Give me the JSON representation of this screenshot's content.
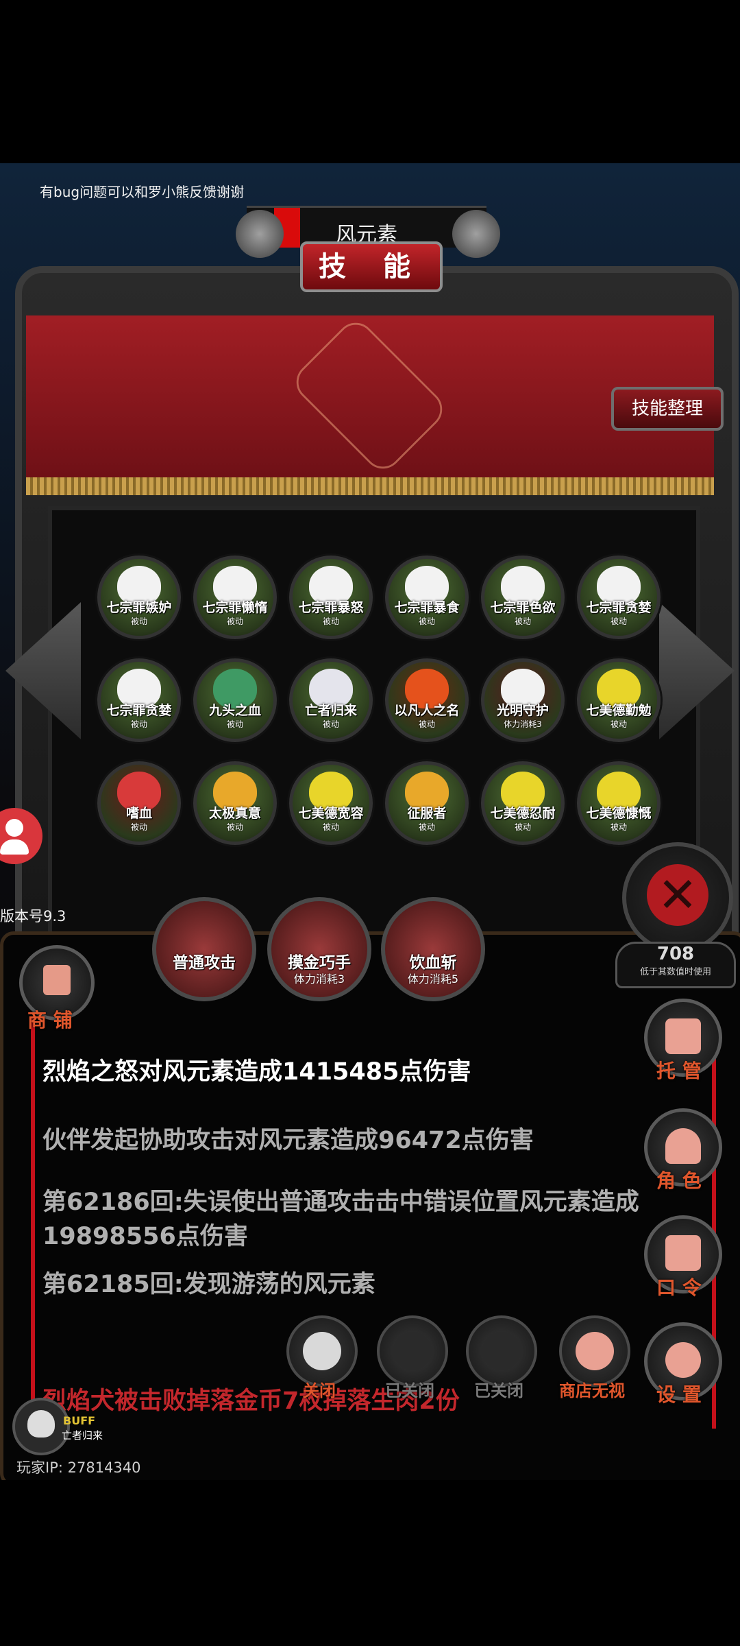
{
  "feedback_note": "有bug问题可以和罗小熊反馈谢谢",
  "target_name": "风元素",
  "panel_title": "技 能",
  "organize_button": "技能整理",
  "skills": [
    {
      "name": "七宗罪嫉妒",
      "sub": "被动",
      "glyph": "mask-icon",
      "bg": "#4f6e34",
      "glyph_color": "#f2f2f2"
    },
    {
      "name": "七宗罪懒惰",
      "sub": "被动",
      "glyph": "mask-icon",
      "bg": "#4f6e34",
      "glyph_color": "#f2f2f2"
    },
    {
      "name": "七宗罪暴怒",
      "sub": "被动",
      "glyph": "mask-icon",
      "bg": "#4f6e34",
      "glyph_color": "#f2f2f2"
    },
    {
      "name": "七宗罪暴食",
      "sub": "被动",
      "glyph": "mask-icon",
      "bg": "#4f6e34",
      "glyph_color": "#f2f2f2"
    },
    {
      "name": "七宗罪色欲",
      "sub": "被动",
      "glyph": "mask-icon",
      "bg": "#4f6e34",
      "glyph_color": "#f2f2f2"
    },
    {
      "name": "七宗罪贪婪",
      "sub": "被动",
      "glyph": "mask-icon",
      "bg": "#4f6e34",
      "glyph_color": "#f2f2f2"
    },
    {
      "name": "七宗罪贪婪",
      "sub": "被动",
      "glyph": "mask-icon",
      "bg": "#4f6e34",
      "glyph_color": "#f2f2f2"
    },
    {
      "name": "九头之血",
      "sub": "被动",
      "glyph": "hydra-icon",
      "bg": "#4f6e34",
      "glyph_color": "#3f9a64"
    },
    {
      "name": "亡者归来",
      "sub": "被动",
      "glyph": "skull-icon",
      "bg": "#4f6e34",
      "glyph_color": "#e4e4ec"
    },
    {
      "name": "以凡人之名",
      "sub": "被动",
      "glyph": "figure-icon",
      "bg": "#6a2a10",
      "glyph_color": "#e5521c"
    },
    {
      "name": "光明守护",
      "sub": "体力消耗3",
      "glyph": "hand-icon",
      "bg": "#5a1a1e",
      "glyph_color": "#f2f2f2"
    },
    {
      "name": "七美德勤勉",
      "sub": "被动",
      "glyph": "tear-icon",
      "bg": "#4f6e34",
      "glyph_color": "#e8d52a"
    },
    {
      "name": "嗜血",
      "sub": "被动",
      "glyph": "fangs-icon",
      "bg": "#6a1a1a",
      "glyph_color": "#d83a3a"
    },
    {
      "name": "太极真意",
      "sub": "被动",
      "glyph": "cloud-icon",
      "bg": "#4f6e34",
      "glyph_color": "#e8a82a"
    },
    {
      "name": "七美德宽容",
      "sub": "被动",
      "glyph": "ribbon-icon",
      "bg": "#4f6e34",
      "glyph_color": "#e8d52a"
    },
    {
      "name": "征服者",
      "sub": "被动",
      "glyph": "lion-icon",
      "bg": "#4f6e34",
      "glyph_color": "#e8a82a"
    },
    {
      "name": "七美德忍耐",
      "sub": "被动",
      "glyph": "swirl-icon",
      "bg": "#4f6e34",
      "glyph_color": "#e8d52a"
    },
    {
      "name": "七美德慷慨",
      "sub": "被动",
      "glyph": "crown-icon",
      "bg": "#4f6e34",
      "glyph_color": "#e8d52a"
    }
  ],
  "version": "版本号9.3",
  "counter": {
    "value": "708",
    "label": "低于其数值时使用"
  },
  "attacks": [
    {
      "label": "普通攻击",
      "sub": ""
    },
    {
      "label": "摸金巧手",
      "sub": "体力消耗3"
    },
    {
      "label": "饮血斩",
      "sub": "体力消耗5"
    }
  ],
  "shop_label": "商 铺",
  "log": [
    {
      "text": "烈焰之怒对风元素造成1415485点伤害",
      "color": "#ffffff"
    },
    {
      "text": "伙伴发起协助攻击对风元素造成96472点伤害",
      "color": "#b0b0b0"
    },
    {
      "text": "第62186回:失误使出普通攻击击中错误位置风元素造成19898556点伤害",
      "color": "#b0b0b0"
    },
    {
      "text": "第62185回:发现游荡的风元素",
      "color": "#b0b0b0"
    },
    {
      "text": "烈焰犬被击败掉落金币7枚掉落生肉2份",
      "color": "#c3272c"
    }
  ],
  "side_buttons": [
    {
      "label": "托 管",
      "icon": "dice-icon"
    },
    {
      "label": "角 色",
      "icon": "hood-icon"
    },
    {
      "label": "口 令",
      "icon": "book-icon"
    },
    {
      "label": "设 置",
      "icon": "gear-icon"
    }
  ],
  "toggles": [
    {
      "label": "关闭",
      "icon": "sound-off-icon",
      "color": "#e0562c"
    },
    {
      "label": "已关闭",
      "icon": "comet-icon",
      "color": "#7a7a7a"
    },
    {
      "label": "已关闭",
      "icon": "dragon-icon",
      "color": "#7a7a7a"
    },
    {
      "label": "商店无视",
      "icon": "money-bag-icon",
      "color": "#e0562c"
    }
  ],
  "buff": {
    "tag": "BUFF",
    "name": "亡者归来"
  },
  "player_ip": "玩家IP: 27814340"
}
